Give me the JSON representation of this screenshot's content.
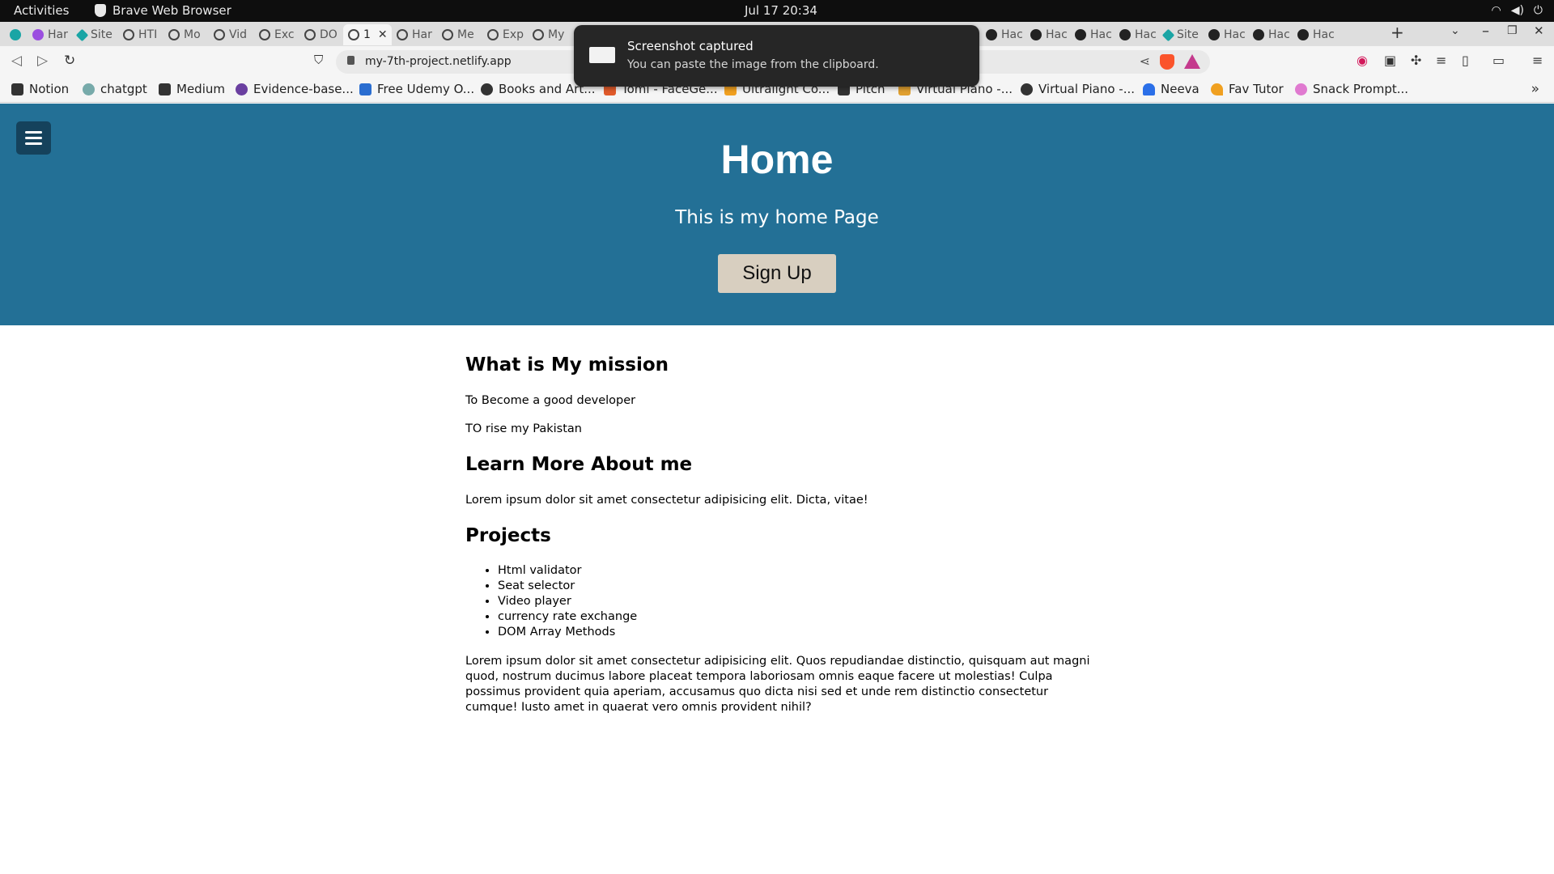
{
  "system": {
    "activities": "Activities",
    "app_name": "Brave Web Browser",
    "clock": "Jul 17  20:34"
  },
  "tabs": [
    {
      "label": "Har",
      "icon": "purple-circle-icon"
    },
    {
      "label": "Site",
      "icon": "teal-diamond-icon"
    },
    {
      "label": "HTI",
      "icon": "globe-icon"
    },
    {
      "label": "Mo",
      "icon": "globe-icon"
    },
    {
      "label": "Vid",
      "icon": "globe-icon"
    },
    {
      "label": "Exc",
      "icon": "globe-icon"
    },
    {
      "label": "DO",
      "icon": "globe-icon"
    },
    {
      "label": "1",
      "icon": "globe-icon",
      "active": true
    },
    {
      "label": "Har",
      "icon": "globe-icon"
    },
    {
      "label": "Me",
      "icon": "globe-icon"
    },
    {
      "label": "Exp",
      "icon": "globe-icon"
    },
    {
      "label": "My",
      "icon": "globe-icon"
    },
    {
      "label": "Hac",
      "icon": "github-icon"
    },
    {
      "label": "Hac",
      "icon": "github-icon"
    },
    {
      "label": "Hac",
      "icon": "github-icon"
    },
    {
      "label": "Hac",
      "icon": "github-icon"
    },
    {
      "label": "Site",
      "icon": "teal-diamond-icon"
    },
    {
      "label": "Hac",
      "icon": "github-icon"
    },
    {
      "label": "Hac",
      "icon": "github-icon"
    },
    {
      "label": "Hac",
      "icon": "github-icon"
    }
  ],
  "toolbar": {
    "url": "my-7th-project.netlify.app"
  },
  "bookmarks": [
    "Notion",
    "chatgpt",
    "Medium",
    "Evidence-base...",
    "Free Udemy O...",
    "Books and Art...",
    "Tomi - FaceGe...",
    "Ultralight Co...",
    "Pitch",
    "Virtual Piano -...",
    "Virtual Piano -...",
    "Neeva",
    "Fav Tutor",
    "Snack Prompt..."
  ],
  "notification": {
    "title": "Screenshot captured",
    "body": "You can paste the image from the clipboard."
  },
  "page": {
    "hero": {
      "title": "Home",
      "subtitle": "This is my home Page",
      "button": "Sign Up"
    },
    "mission": {
      "heading": "What is My mission",
      "lines": [
        "To Become a good developer",
        "TO rise my Pakistan"
      ]
    },
    "about": {
      "heading": "Learn More About me",
      "text": "Lorem ipsum dolor sit amet consectetur adipisicing elit. Dicta, vitae!"
    },
    "projects": {
      "heading": "Projects",
      "items": [
        "Html validator",
        "Seat selector",
        "Video player",
        "currency rate exchange",
        "DOM Array Methods"
      ],
      "text": "Lorem ipsum dolor sit amet consectetur adipisicing elit. Quos repudiandae distinctio, quisquam aut magni quod, nostrum ducimus labore placeat tempora laboriosam omnis eaque facere ut molestias! Culpa possimus provident quia aperiam, accusamus quo dicta nisi sed et unde rem distinctio consectetur cumque! Iusto amet in quaerat vero omnis provident nihil?"
    }
  },
  "colors": {
    "hero_bg": "#237096",
    "menu_button": "#15425c",
    "signup_bg": "#d8cfc0"
  }
}
